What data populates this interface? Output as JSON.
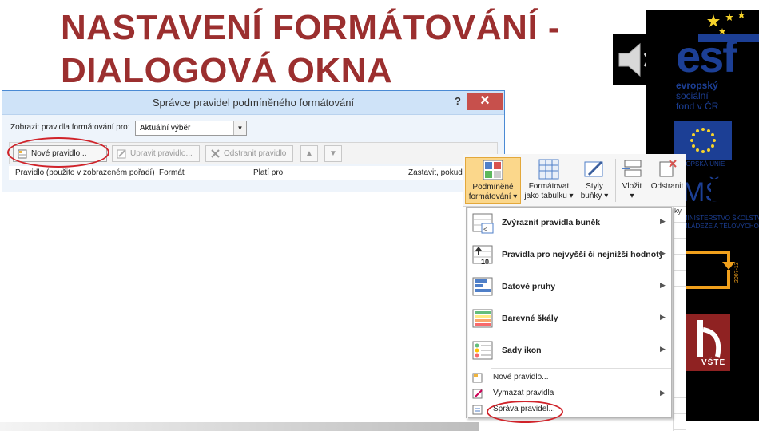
{
  "slide": {
    "title_line1": "NASTAVENÍ FORMÁTOVÁNÍ  -",
    "title_line2": "DIALOGOVÁ OKNA"
  },
  "logos": {
    "esf_text": "esf",
    "esf_caption": [
      "evropský",
      "sociální",
      "fond v ČR"
    ],
    "eu_caption": "EVROPSKÁ UNIE",
    "msmt_caption_1": "MINISTERSTVO ŠKOLSTVÍ,",
    "msmt_caption_2": "MLÁDEŽE A TĚLOVÝCHOVY",
    "op_years": "2007-13",
    "vste_text": "VŠTE"
  },
  "dialog": {
    "title": "Správce pravidel podmíněného formátování",
    "help": "?",
    "close": "✕",
    "show_label": "Zobrazit pravidla formátování pro:",
    "show_value": "Aktuální výběr",
    "buttons": {
      "new_rule": "Nové pravidlo...",
      "edit_rule": "Upravit pravidlo...",
      "delete_rule": "Odstranit pravidlo"
    },
    "columns": [
      "Pravidlo (použito v zobrazeném pořadí)",
      "Formát",
      "Platí pro",
      "Zastavit, pokud"
    ]
  },
  "ribbon": {
    "items": [
      {
        "line1": "Podmíněné",
        "line2": "formátování ▾"
      },
      {
        "line1": "Formátovat",
        "line2": "jako tabulku ▾"
      },
      {
        "line1": "Styly",
        "line2": "buňky ▾"
      },
      {
        "line1": "Vložit",
        "line2": "▾"
      },
      {
        "line1": "Odstranit",
        "line2": ""
      }
    ],
    "cells_label": "ky"
  },
  "menu": {
    "items": [
      {
        "label": "Zvýraznit pravidla buněk"
      },
      {
        "label": "Pravidla pro nejvyšší či nejnižší hodnoty"
      },
      {
        "label": "Datové pruhy"
      },
      {
        "label": "Barevné škály"
      },
      {
        "label": "Sady ikon"
      }
    ],
    "small_items": [
      {
        "label": "Nové pravidlo..."
      },
      {
        "label": "Vymazat pravidla"
      },
      {
        "label": "Správa pravidel..."
      }
    ]
  },
  "colors": {
    "title": "#9b2f2f",
    "highlight_oval": "#d0232a",
    "active_ribbon": "#fbd78b"
  }
}
